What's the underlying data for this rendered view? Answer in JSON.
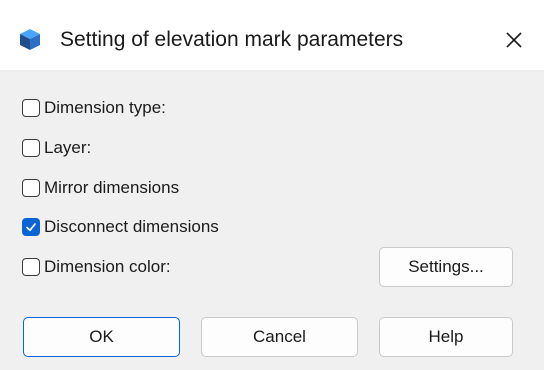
{
  "dialog": {
    "title": "Setting of elevation mark parameters",
    "close_glyph": "✕",
    "icon": "app-cube-icon"
  },
  "options": [
    {
      "label": "Dimension type:",
      "checked": false
    },
    {
      "label": "Layer:",
      "checked": false
    },
    {
      "label": "Mirror dimensions",
      "checked": false
    },
    {
      "label": "Disconnect dimensions",
      "checked": true
    },
    {
      "label": "Dimension color:",
      "checked": false
    }
  ],
  "buttons": {
    "settings": "Settings...",
    "ok": "OK",
    "cancel": "Cancel",
    "help": "Help"
  },
  "colors": {
    "accent": "#0a64d6",
    "content_bg": "#f0f0f0"
  }
}
